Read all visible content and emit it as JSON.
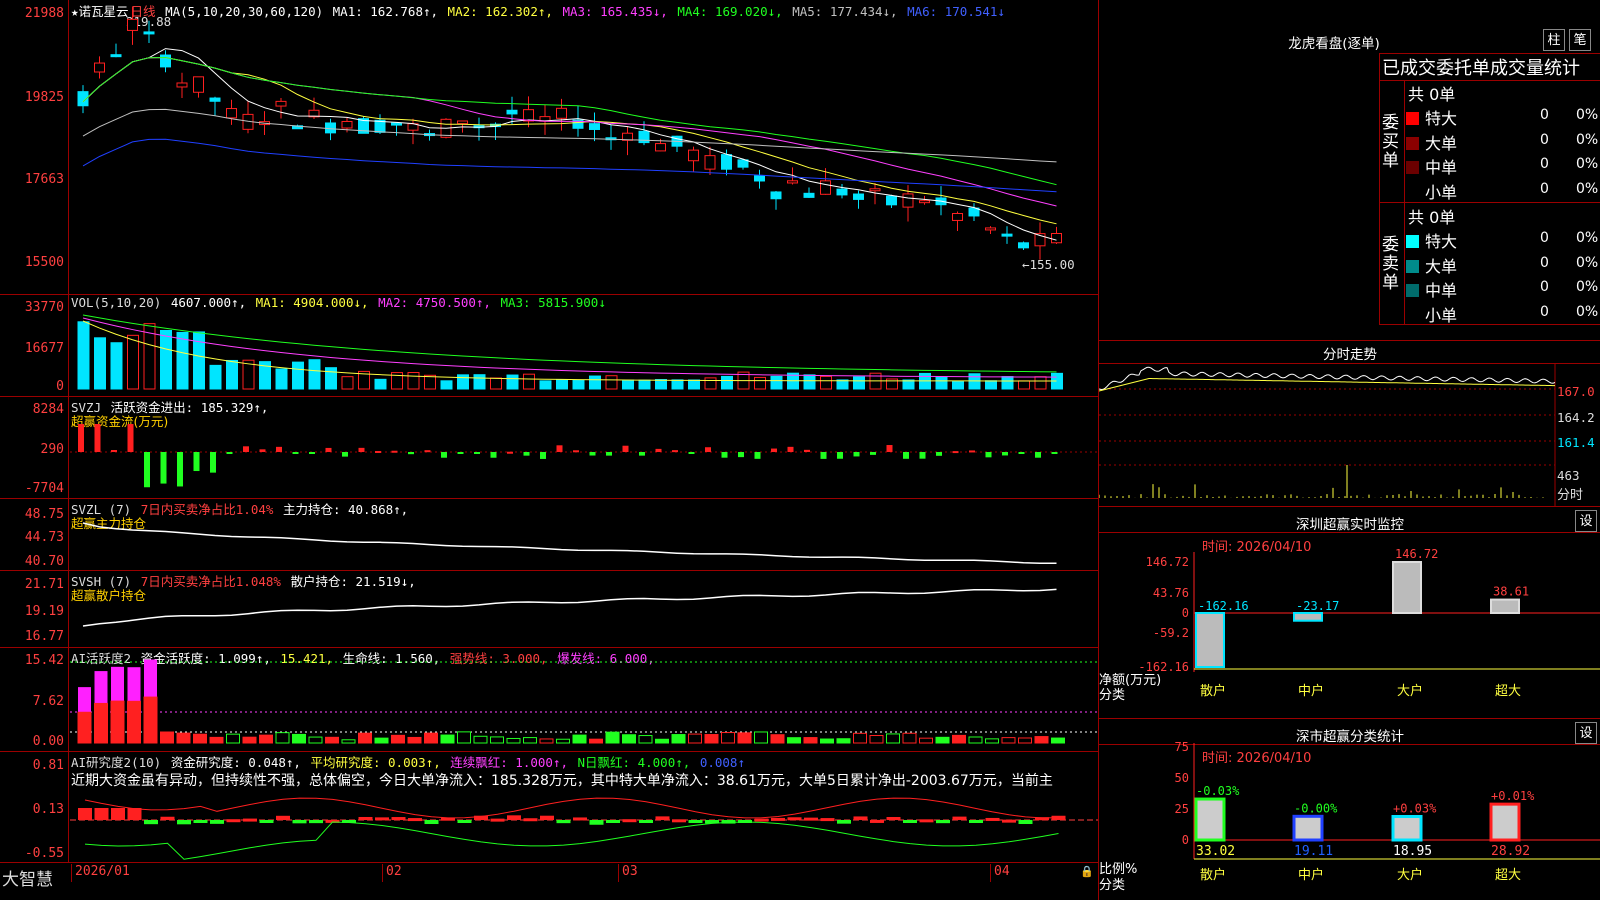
{
  "stock": {
    "name": "★诺瓦星云",
    "period": "日线"
  },
  "colors": {
    "up": "#ff2020",
    "down": "#00e5ff",
    "ma1": "#ffffff",
    "ma2": "#ffff40",
    "ma3": "#ff40ff",
    "ma4": "#20ff20",
    "ma5": "#c0c0c0",
    "ma6": "#2040ff",
    "grid": "#9b0000"
  },
  "price_panel": {
    "ma_label": "MA(5,10,20,30,60,120)",
    "ma1": "MA1: 162.768↑,",
    "ma2": "MA2: 162.302↑,",
    "ma3": "MA3: 165.435↓,",
    "ma4": "MA4: 169.020↓,",
    "ma5": "MA5: 177.434↓,",
    "ma6": "MA6: 170.541↓",
    "y_labels": [
      "21988",
      "19825",
      "17663",
      "15500"
    ],
    "high_mark": "219.88",
    "low_mark": "←155.00"
  },
  "vol_panel": {
    "label": "VOL(5,10,20)",
    "value": "4607.000↑,",
    "ma1": "MA1: 4904.000↓,",
    "ma2": "MA2: 4750.500↑,",
    "ma3": "MA3: 5815.900↓",
    "y_labels": [
      "33770",
      "16677",
      "0"
    ]
  },
  "svzj_panel": {
    "label": "SVZJ",
    "text": "活跃资金进出: 185.329↑,",
    "subtitle": "超赢资金流(万元)",
    "y_labels": [
      "8284",
      "290",
      "-7704"
    ]
  },
  "svzl_panel": {
    "label": "SVZL (7)",
    "text1": "7日内买卖净占比1.04%",
    "text2": "主力持仓: 40.868↑,",
    "subtitle": "超赢主力持仓",
    "y_labels": [
      "48.75",
      "44.73",
      "40.70"
    ]
  },
  "svsh_panel": {
    "label": "SVSH (7)",
    "text1": "7日内买卖净占比1.048%",
    "text2": "散户持仓: 21.519↓,",
    "subtitle": "超赢散户持仓",
    "y_labels": [
      "21.71",
      "19.19",
      "16.77"
    ]
  },
  "ai1_panel": {
    "label": "AI活跃度2",
    "t1": "资金活跃度: 1.099↑,",
    "t2": "15.421,",
    "t3": "生命线: 1.560,",
    "t4": "强势线: 3.000,",
    "t5": "爆发线: 6.000,",
    "y_labels": [
      "15.42",
      "7.62",
      "0.00"
    ]
  },
  "ai2_panel": {
    "label": "AI研究度2(10)",
    "t1": "资金研究度: 0.048↑,",
    "t2": "平均研究度: 0.003↑,",
    "t3": "连续飘红: 1.000↑,",
    "t4": "N日飘红: 4.000↑,",
    "t5": "0.008↑",
    "comment": "近期大资金虽有异动，但持续性不强，总体偏空，今日大单净流入：185.328万元，其中特大单净流入：38.61万元，大单5日累计净出-2003.67万元，当前主",
    "y_labels": [
      "0.81",
      "0.13",
      "-0.55"
    ]
  },
  "x_axis": {
    "labels": [
      "2026/01",
      "02",
      "03",
      "04"
    ],
    "brand": "大智慧"
  },
  "dragon": {
    "title": "龙虎看盘(逐单)",
    "btn1": "柱",
    "btn2": "笔",
    "header": "已成交委托单成交量统计",
    "buy_label": "委买单",
    "sell_label": "委卖单",
    "buy_total": "共 0单",
    "sell_total": "共 0单",
    "rows": [
      {
        "name": "特大",
        "count": "0",
        "pct": "0%"
      },
      {
        "name": "大单",
        "count": "0",
        "pct": "0%"
      },
      {
        "name": "中单",
        "count": "0",
        "pct": "0%"
      },
      {
        "name": "小单",
        "count": "0",
        "pct": "0%"
      }
    ],
    "buy_colors": [
      "#ff0000",
      "#8b0000",
      "#6b0000",
      "#000000"
    ],
    "sell_colors": [
      "#00ffff",
      "#008b8b",
      "#006b6b",
      "#000000"
    ]
  },
  "fenshi": {
    "title": "分时走势",
    "labels": [
      "167.0",
      "164.2",
      "161.4",
      "463",
      "分时"
    ]
  },
  "monitor": {
    "title": "深圳超赢实时监控",
    "btn": "设",
    "time": "时间: 2026/04/10",
    "y_labels": [
      "146.72",
      "43.76",
      "0",
      "-59.2",
      "-162.16"
    ],
    "y_unit_1": "净额(万元)",
    "y_unit_2": "分类",
    "cats": [
      "散户",
      "中户",
      "大户",
      "超大"
    ],
    "values": [
      -162.16,
      -23.17,
      146.72,
      38.61
    ],
    "value_labels": [
      "-162.16",
      "-23.17",
      "146.72",
      "38.61"
    ]
  },
  "classify": {
    "title": "深市超赢分类统计",
    "btn": "设",
    "time": "时间: 2026/04/10",
    "y_labels": [
      "75",
      "50",
      "25",
      "0"
    ],
    "y_unit_1": "比例%",
    "y_unit_2": "分类",
    "cats": [
      "散户",
      "中户",
      "大户",
      "超大"
    ],
    "values": [
      33.02,
      19.11,
      18.95,
      28.92
    ],
    "value_labels": [
      "33.02",
      "19.11",
      "18.95",
      "28.92"
    ],
    "change_labels": [
      "-0.03%",
      "-0.00%",
      "+0.03%",
      "+0.01%"
    ]
  }
}
